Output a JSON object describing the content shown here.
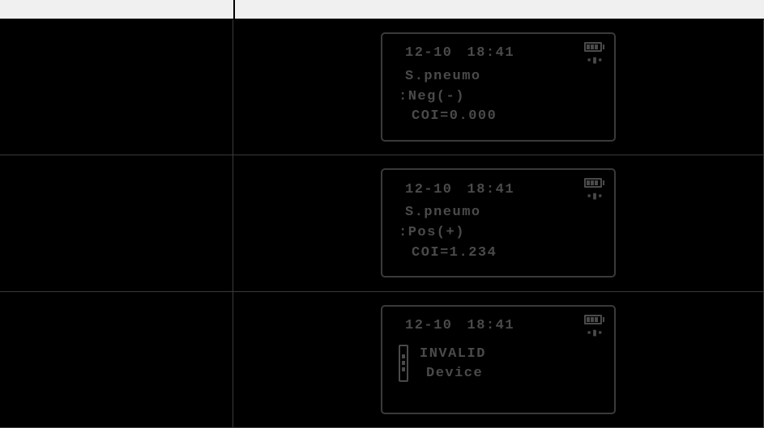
{
  "rows": [
    {
      "date": "12-10",
      "time": "18:41",
      "test_name": "S.pneumo",
      "result_line": ":Neg(-)",
      "coi_line": "COI=0.000"
    },
    {
      "date": "12-10",
      "time": "18:41",
      "test_name": "S.pneumo",
      "result_line": ":Pos(+)",
      "coi_line": "COI=1.234"
    },
    {
      "date": "12-10",
      "time": "18:41",
      "error_line1": "INVALID",
      "error_line2": "Device"
    }
  ]
}
